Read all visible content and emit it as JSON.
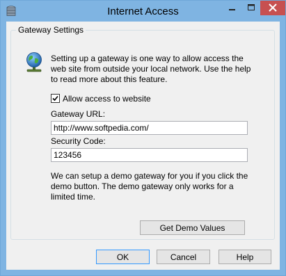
{
  "window": {
    "title": "Internet Access"
  },
  "group": {
    "title": "Gateway Settings",
    "intro": "Setting up a gateway is one way to allow access the web site from outside your local network. Use the help to read more about this feature."
  },
  "form": {
    "allow_label": "Allow access to website",
    "allow_checked": true,
    "url_label": "Gateway URL:",
    "url_value": "http://www.softpedia.com/",
    "code_label": "Security Code:",
    "code_value": "123456",
    "demo_text": "We can setup a demo gateway for you if you click the demo button. The demo gateway only works for a limited time.",
    "demo_button": "Get Demo Values"
  },
  "buttons": {
    "ok": "OK",
    "cancel": "Cancel",
    "help": "Help"
  },
  "colors": {
    "frame": "#7fb4e2",
    "close": "#c75050",
    "dialog_bg": "#f0f0f0",
    "focus_border": "#3399ff"
  },
  "icons": {
    "app": "server-stack-icon",
    "info": "globe-network-icon",
    "minimize": "minimize-icon",
    "maximize": "maximize-icon",
    "close": "close-icon"
  }
}
